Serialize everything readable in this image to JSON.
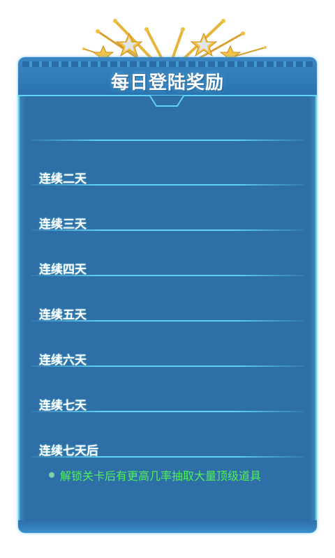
{
  "header": {
    "title": "每日登陆奖励"
  },
  "rows": [
    {
      "label": "连续二天"
    },
    {
      "label": "连续三天"
    },
    {
      "label": "连续四天"
    },
    {
      "label": "连续五天"
    },
    {
      "label": "连续六天"
    },
    {
      "label": "连续七天"
    },
    {
      "label": "连续七天后"
    }
  ],
  "hint": {
    "text": "解锁关卡后有更高几率抽取大量顶级道具",
    "icon": "bullet-dot-icon"
  },
  "colors": {
    "panel": "#2d6fa6",
    "border": "#5fd0f2",
    "hint_text": "#52f05a",
    "star": "#e9a816"
  }
}
